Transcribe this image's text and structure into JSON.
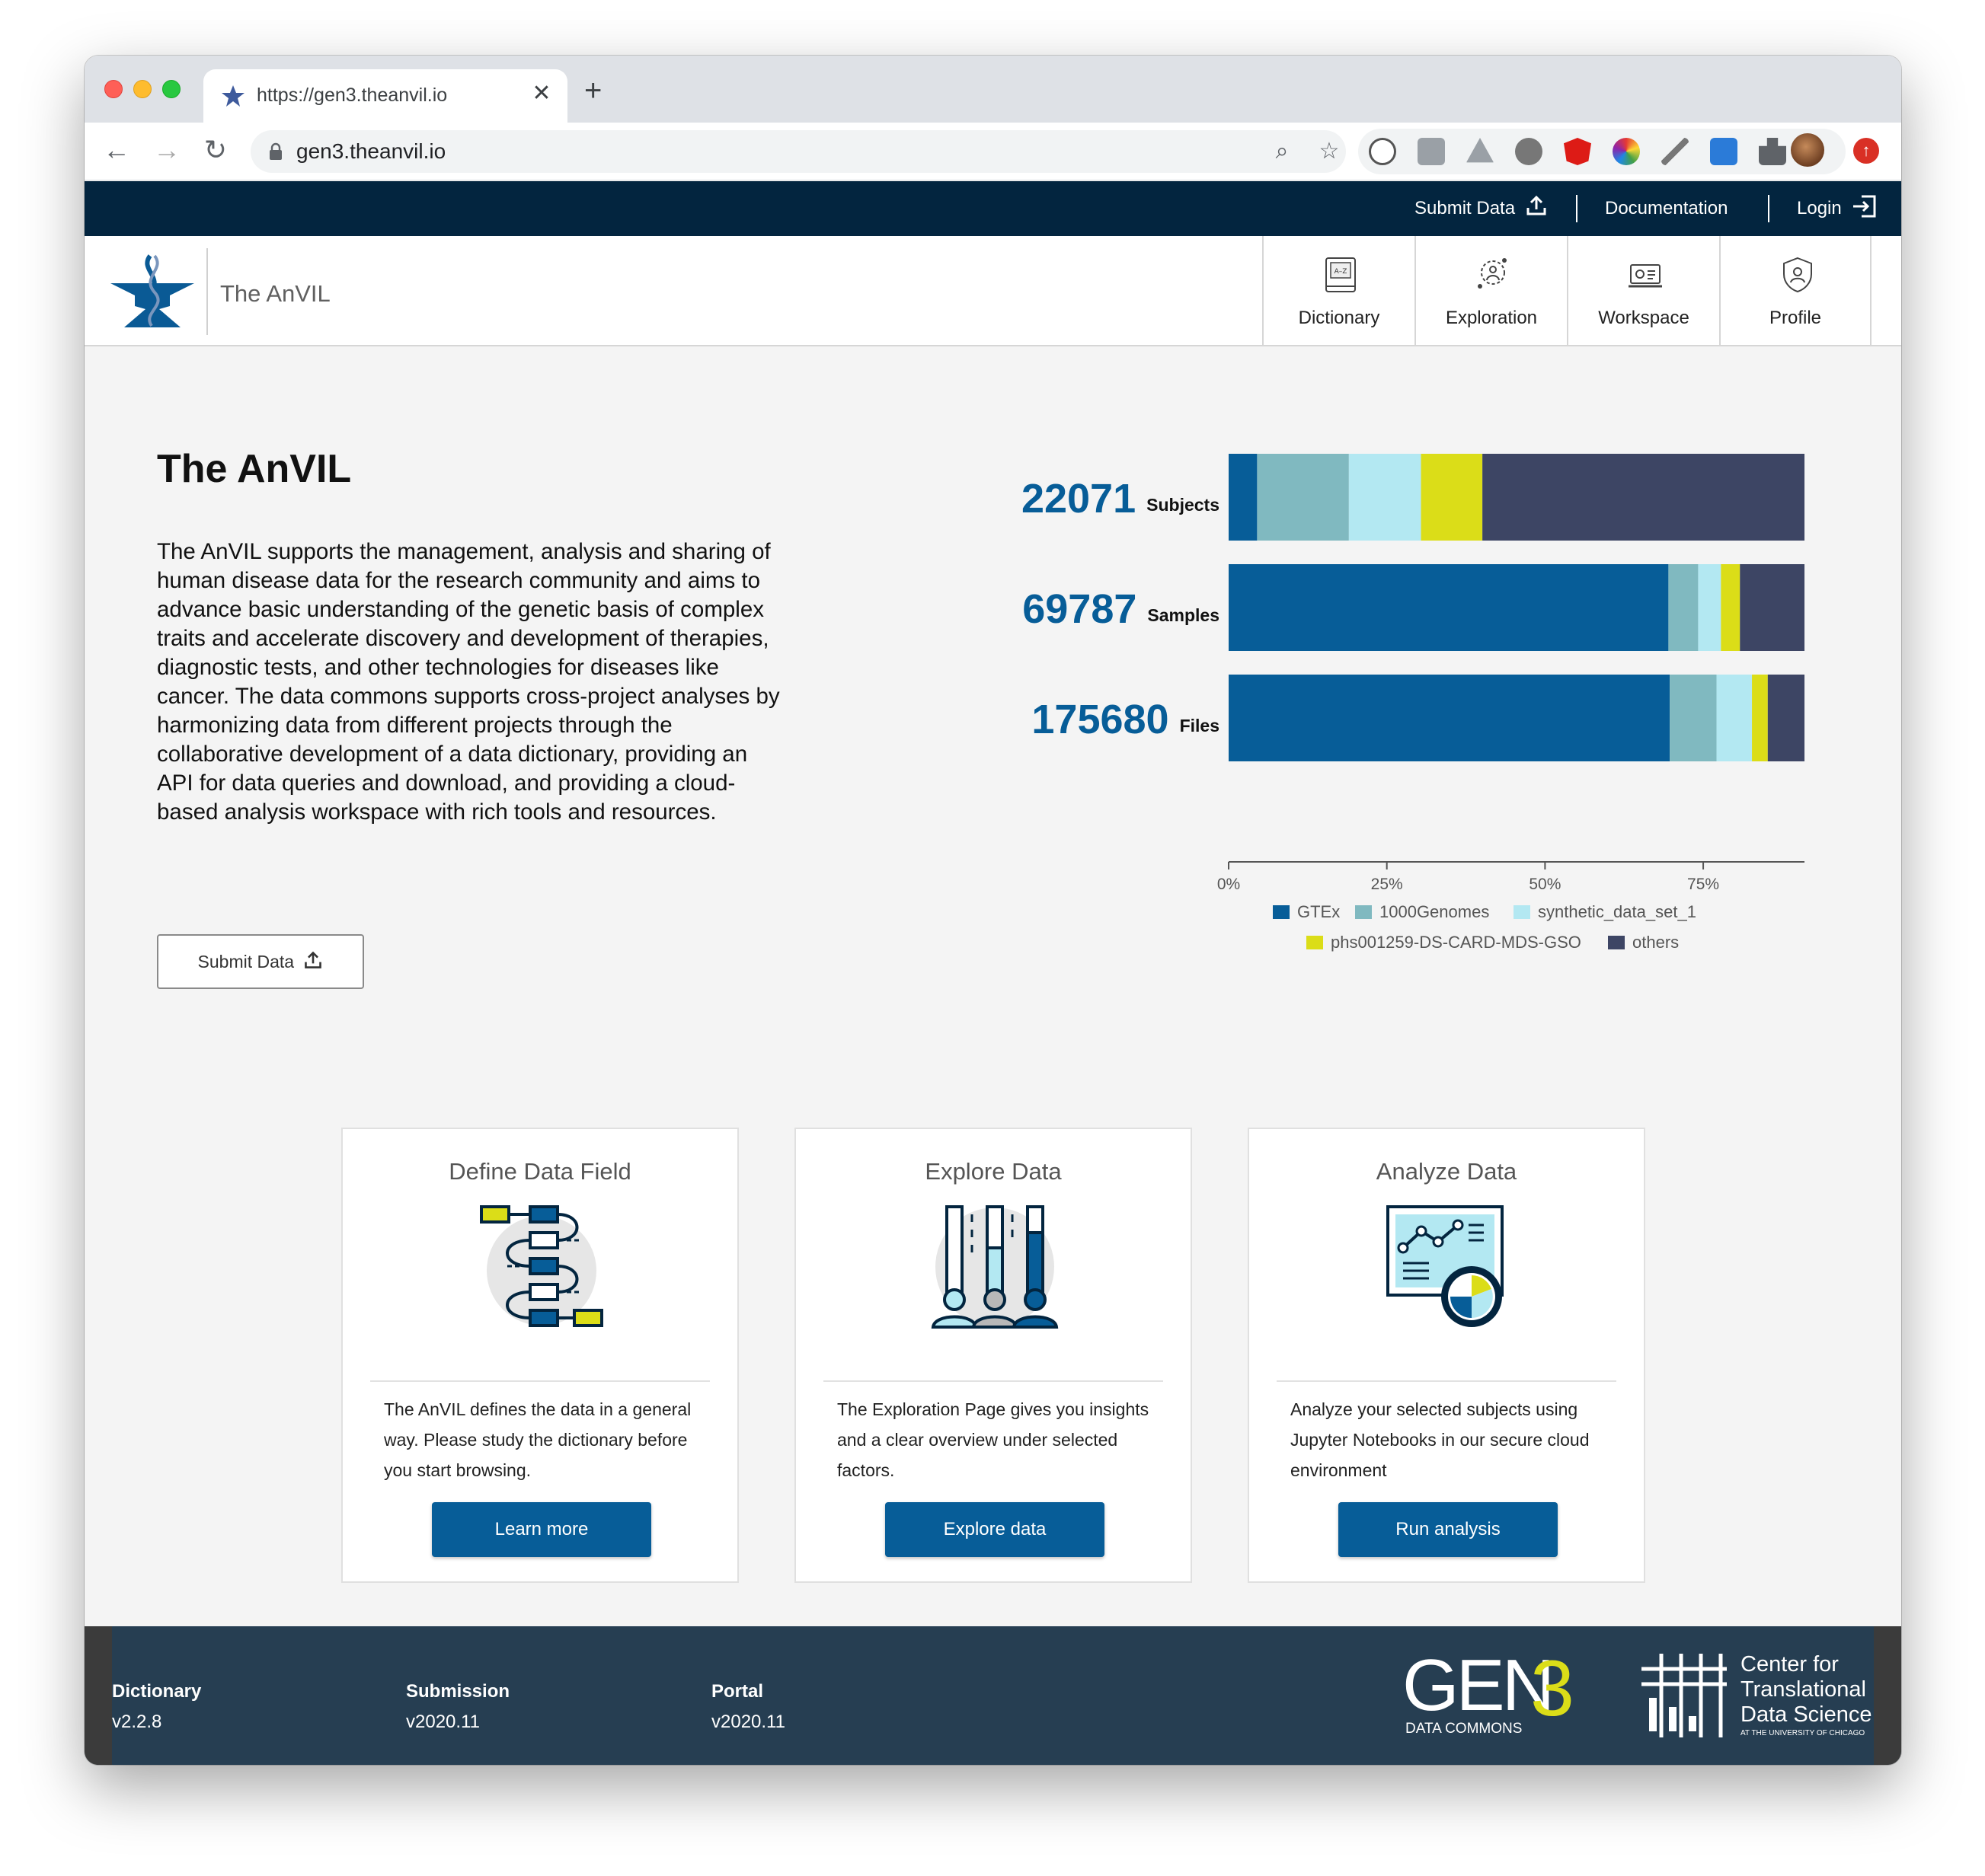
{
  "browser": {
    "tab_title": "https://gen3.theanvil.io",
    "url": "gen3.theanvil.io",
    "close_glyph": "✕",
    "new_tab_glyph": "+"
  },
  "topbar": {
    "submit": "Submit Data",
    "docs": "Documentation",
    "login": "Login"
  },
  "header": {
    "brand": "The AnVIL",
    "nav": [
      "Dictionary",
      "Exploration",
      "Workspace",
      "Profile"
    ]
  },
  "hero": {
    "title": "The AnVIL",
    "body": "The AnVIL supports the management, analysis and sharing of human disease data for the research community and aims to advance basic understanding of the genetic basis of complex traits and accelerate discovery and development of therapies, diagnostic tests, and other technologies for diseases like cancer. The data commons supports cross-project analyses by harmonizing data from different projects through the collaborative development of a data dictionary, providing an API for data queries and download, and providing a cloud-based analysis workspace with rich tools and resources.",
    "submit_button": "Submit Data"
  },
  "chart_data": {
    "type": "bar",
    "orientation": "horizontal-stacked",
    "categories": [
      "Subjects",
      "Samples",
      "Files"
    ],
    "counts": [
      "22071",
      "69787",
      "175680"
    ],
    "x_ticks": [
      "0%",
      "25%",
      "50%",
      "75%"
    ],
    "xlim": [
      0,
      91
    ],
    "series": [
      {
        "name": "GTEx",
        "color": "#075d98",
        "values": [
          4.5,
          69.5,
          69.7
        ]
      },
      {
        "name": "1000Genomes",
        "color": "#80b9c0",
        "values": [
          14.5,
          4.7,
          7.4
        ]
      },
      {
        "name": "synthetic_data_set_1",
        "color": "#b3e8f2",
        "values": [
          11.4,
          3.6,
          5.6
        ]
      },
      {
        "name": "phs001259-DS-CARD-MDS-GSO",
        "color": "#dbdd18",
        "values": [
          9.7,
          3.0,
          2.5
        ]
      },
      {
        "name": "others",
        "color": "#3d4564",
        "values": [
          50.9,
          10.2,
          5.8
        ]
      }
    ]
  },
  "cards": [
    {
      "title": "Define Data Field",
      "text": "The AnVIL defines the data in a general way. Please study the dictionary before you start browsing.",
      "button": "Learn more"
    },
    {
      "title": "Explore Data",
      "text": "The Exploration Page gives you insights and a clear overview under selected factors.",
      "button": "Explore data"
    },
    {
      "title": "Analyze Data",
      "text": "Analyze your selected subjects using Jupyter Notebooks in our secure cloud environment",
      "button": "Run analysis"
    }
  ],
  "footer": {
    "cols": [
      {
        "label": "Dictionary",
        "version": "v2.2.8"
      },
      {
        "label": "Submission",
        "version": "v2020.11"
      },
      {
        "label": "Portal",
        "version": "v2020.11"
      }
    ],
    "gen3_big": "GEN",
    "gen3_three": "3",
    "gen3_sub": "DATA COMMONS",
    "ctds": [
      "Center for",
      "Translational",
      "Data Science"
    ],
    "ctds_sub": "AT THE UNIVERSITY OF CHICAGO"
  }
}
